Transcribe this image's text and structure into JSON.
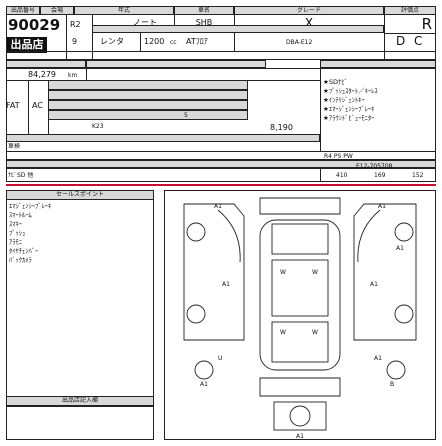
{
  "header": {
    "lot_label": "出品番号",
    "venue_label": "会場",
    "year_label": "年式",
    "maker_label": "車名",
    "model_label": "グレード",
    "score_label": "評価点",
    "lot_number": "90029",
    "year": "R2",
    "car_name": "ノート",
    "grade": "SHB",
    "color": "X",
    "score": "R",
    "exhibit_badge": "出品店",
    "sub_a": "9",
    "sub_b": "レンタ",
    "displacement": "1200",
    "displacement_unit": "cc",
    "transmission": "ATﾌﾛｱ",
    "model_code": "DBA-E12",
    "drive": "D",
    "code_c": "C"
  },
  "mileage": {
    "value": "84,279",
    "unit": "km"
  },
  "equipment": {
    "fat": "FAT",
    "ac": "AC",
    "shift": "K23",
    "date": "8,190",
    "doors": "5",
    "seats": "D"
  },
  "options": [
    "★SDﾅﾋﾞ",
    "★ﾌﾟｯｼｭｽﾀｰﾄ／ｷｰﾚｽ",
    "★ｲﾝﾃﾘｼﾞｪﾝﾄｷｰ",
    "★ｴﾏｰｼﾞｪﾝｼｰﾌﾞﾚｰｷ",
    "★ｱﾗｳﾝﾄﾞﾋﾞｭｰﾓﾆﾀｰ"
  ],
  "inspection": {
    "label": "車検",
    "value": "R4 PS PW",
    "serial": "E12-705708",
    "left_text": "ﾅﾋﾞSD 他"
  },
  "sizes": {
    "length": "410",
    "width": "169",
    "height": "152"
  },
  "notes": {
    "title": "セールスポイント",
    "lines": [
      "ｴﾏｼﾞｪﾝｼｰﾌﾞﾚｰｷ",
      "ｽﾏｰﾄﾙｰﾑ",
      "ｽﾏｷｰ",
      "ﾌﾟｯｼｭ",
      "ｱﾗﾓﾆ",
      "ﾀｲﾔﾁｪﾝﾊﾞｰ",
      "ﾊﾞｯｸｶﾒﾗ"
    ],
    "footer": "出品店記入欄"
  },
  "diagram": {
    "marks": [
      "A1",
      "A1",
      "W",
      "W",
      "A1",
      "A1",
      "W",
      "A1",
      "U",
      "A1",
      "A1",
      "B",
      "W",
      "A1"
    ]
  }
}
